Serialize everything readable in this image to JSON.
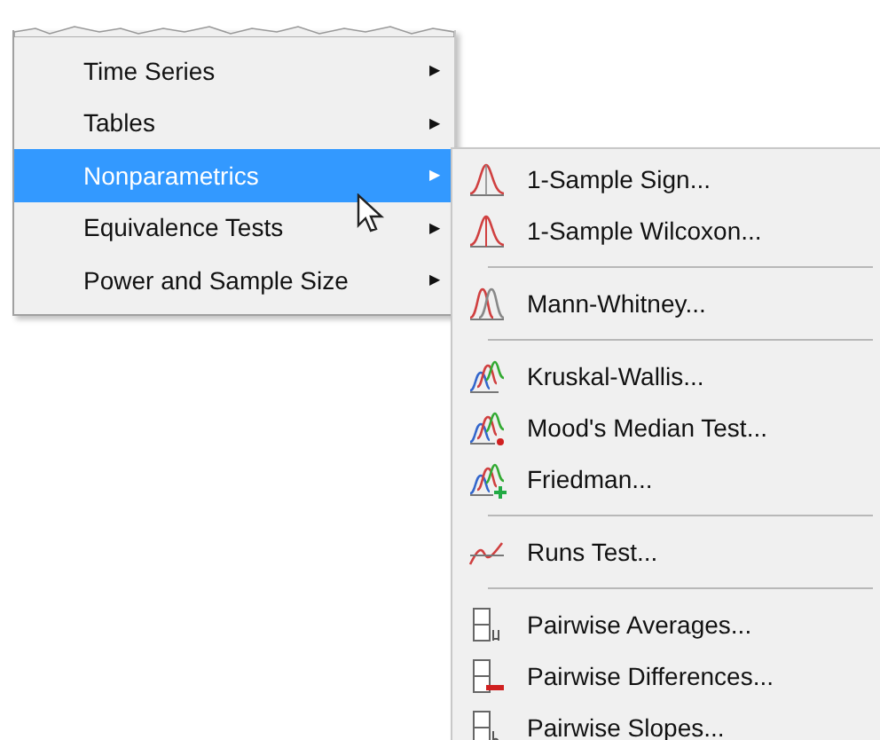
{
  "menu": {
    "items": [
      {
        "label": "Time Series",
        "selected": false,
        "arrow": "▶"
      },
      {
        "label": "Tables",
        "selected": false,
        "arrow": "▶"
      },
      {
        "label": "Nonparametrics",
        "selected": true,
        "arrow": "▶"
      },
      {
        "label": "Equivalence Tests",
        "selected": false,
        "arrow": "▶"
      },
      {
        "label": "Power and Sample Size",
        "selected": false,
        "arrow": "▶"
      }
    ]
  },
  "submenu": {
    "entries": [
      {
        "kind": "item",
        "label": "1-Sample Sign..."
      },
      {
        "kind": "item",
        "label": "1-Sample Wilcoxon..."
      },
      {
        "kind": "separator"
      },
      {
        "kind": "item",
        "label": "Mann-Whitney..."
      },
      {
        "kind": "separator"
      },
      {
        "kind": "item",
        "label": "Kruskal-Wallis..."
      },
      {
        "kind": "item",
        "label": "Mood's Median Test..."
      },
      {
        "kind": "item",
        "label": "Friedman..."
      },
      {
        "kind": "separator"
      },
      {
        "kind": "item",
        "label": "Runs Test..."
      },
      {
        "kind": "separator"
      },
      {
        "kind": "item",
        "label": "Pairwise Averages..."
      },
      {
        "kind": "item",
        "label": "Pairwise Differences..."
      },
      {
        "kind": "item",
        "label": "Pairwise Slopes..."
      }
    ]
  }
}
